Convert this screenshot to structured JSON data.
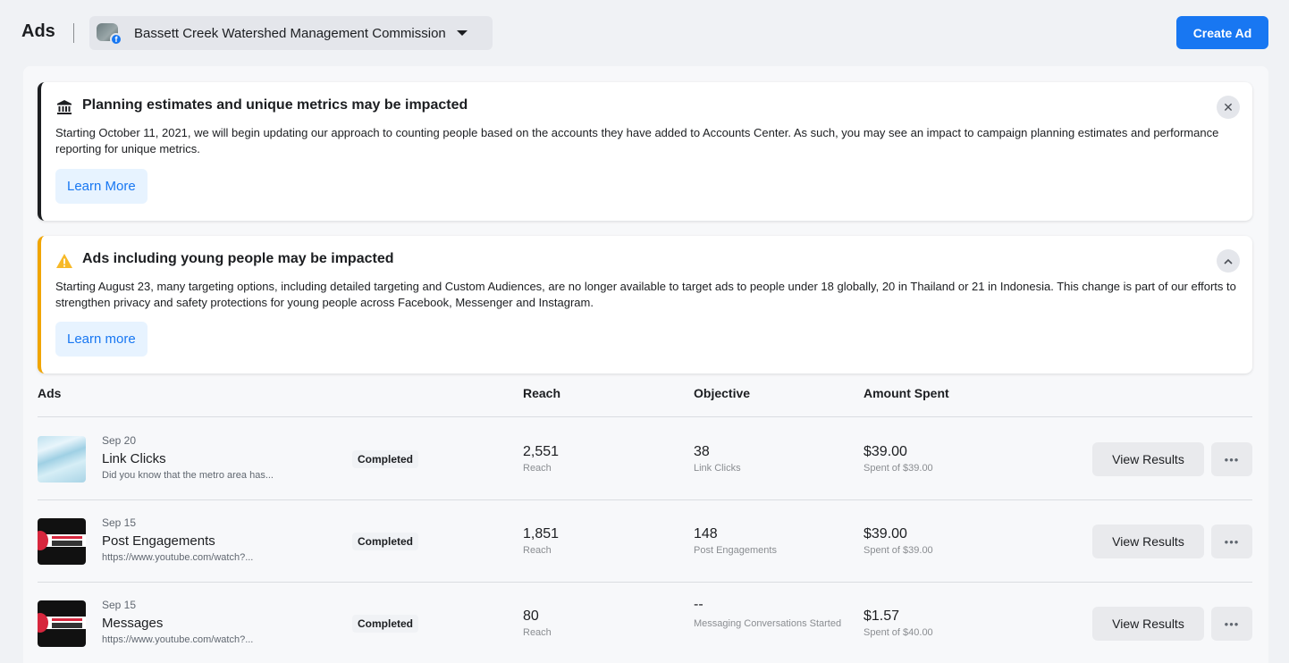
{
  "header": {
    "title": "Ads",
    "page_name": "Bassett Creek Watershed Management Commission",
    "create_label": "Create Ad"
  },
  "notices": [
    {
      "icon": "bank-icon",
      "title": "Planning estimates and unique metrics may be impacted",
      "body": "Starting October 11, 2021, we will begin updating our approach to counting people based on the accounts they have added to Accounts Center. As such, you may see an impact to campaign planning estimates and performance reporting for unique metrics.",
      "button": "Learn More",
      "action_icon": "close-icon"
    },
    {
      "icon": "warning-icon",
      "title": "Ads including young people may be impacted",
      "body": "Starting August 23, many targeting options, including detailed targeting and Custom Audiences, are no longer available to target ads to people under 18 globally, 20 in Thailand or 21 in Indonesia. This change is part of our efforts to strengthen privacy and safety protections for young people across Facebook, Messenger and Instagram.",
      "button": "Learn more",
      "action_icon": "chevron-up-icon"
    }
  ],
  "table": {
    "columns": [
      "Ads",
      "Reach",
      "Objective",
      "Amount Spent"
    ],
    "rows": [
      {
        "date": "Sep 20",
        "name": "Link Clicks",
        "desc": "Did you know that the metro area has...",
        "status": "Completed",
        "reach": "2,551",
        "reach_label": "Reach",
        "objective": "38",
        "objective_label": "Link Clicks",
        "spent": "$39.00",
        "spent_label": "Spent of $39.00",
        "view_label": "View Results",
        "more": "•••"
      },
      {
        "date": "Sep 15",
        "name": "Post Engagements",
        "desc": "https://www.youtube.com/watch?...",
        "status": "Completed",
        "reach": "1,851",
        "reach_label": "Reach",
        "objective": "148",
        "objective_label": "Post Engagements",
        "spent": "$39.00",
        "spent_label": "Spent of $39.00",
        "view_label": "View Results",
        "more": "•••"
      },
      {
        "date": "Sep 15",
        "name": "Messages",
        "desc": "https://www.youtube.com/watch?...",
        "status": "Completed",
        "reach": "80",
        "reach_label": "Reach",
        "objective": "--",
        "objective_label": "Messaging Conversations Started",
        "spent": "$1.57",
        "spent_label": "Spent of $40.00",
        "view_label": "View Results",
        "more": "•••"
      }
    ]
  },
  "colors": {
    "accent": "#1877f2",
    "warning": "#f0a500"
  }
}
